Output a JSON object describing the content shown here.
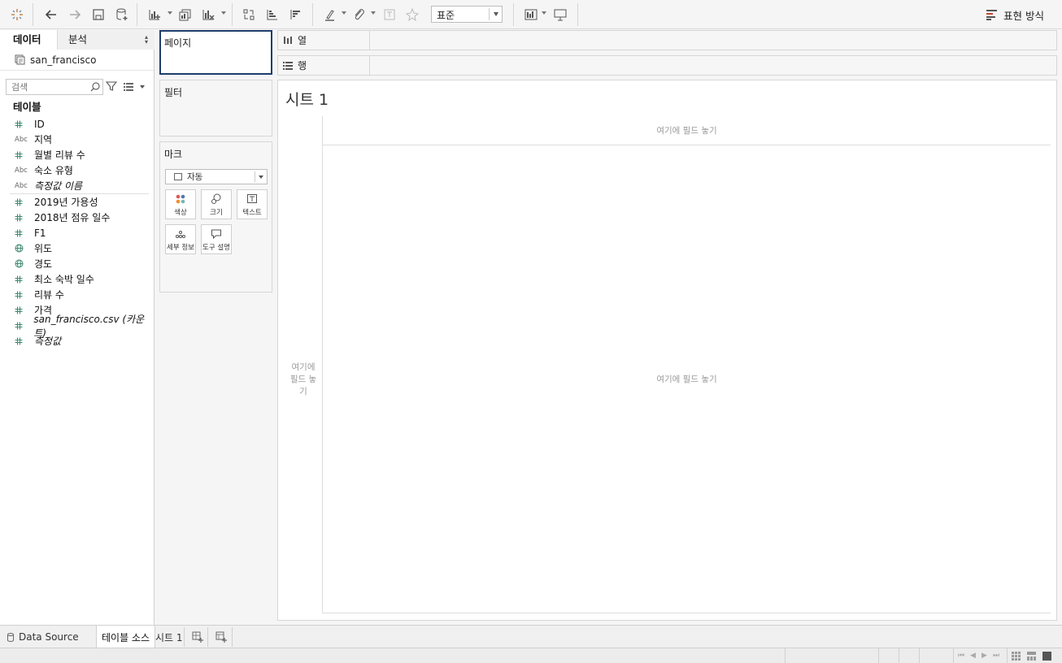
{
  "toolbar": {
    "format_select": "표준",
    "show_me": "표현 방식"
  },
  "data_pane": {
    "tab_data": "데이터",
    "tab_analysis": "분석",
    "datasource": "san_francisco",
    "search_placeholder": "검색",
    "tables_header": "테이블",
    "fields": [
      {
        "type": "#",
        "label": "ID",
        "italic": false
      },
      {
        "type": "Abc",
        "label": "지역",
        "italic": false
      },
      {
        "type": "#",
        "label": "월별 리뷰 수",
        "italic": false
      },
      {
        "type": "Abc",
        "label": "숙소 유형",
        "italic": false
      },
      {
        "type": "Abc",
        "label": "측정값 이름",
        "italic": true
      }
    ],
    "measures": [
      {
        "type": "#",
        "label": "2019년 가용성",
        "italic": false
      },
      {
        "type": "#",
        "label": "2018년 점유 일수",
        "italic": false
      },
      {
        "type": "#",
        "label": "F1",
        "italic": false
      },
      {
        "type": "globe",
        "label": "위도",
        "italic": false
      },
      {
        "type": "globe",
        "label": "경도",
        "italic": false
      },
      {
        "type": "#",
        "label": "최소 숙박 일수",
        "italic": false
      },
      {
        "type": "#",
        "label": "리뷰 수",
        "italic": false
      },
      {
        "type": "#",
        "label": "가격",
        "italic": false
      },
      {
        "type": "#",
        "label": "san_francisco.csv (카운트)",
        "italic": true
      },
      {
        "type": "#",
        "label": "측정값",
        "italic": true
      }
    ]
  },
  "cards": {
    "pages": "페이지",
    "filters": "필터",
    "marks": "마크",
    "mark_type": "자동",
    "color": "색상",
    "size": "크기",
    "text": "텍스트",
    "detail": "세부 정보",
    "tooltip": "도구 설명"
  },
  "shelves": {
    "columns": "열",
    "rows": "행"
  },
  "canvas": {
    "sheet_title": "시트 1",
    "drop_field_top": "여기에 필드 놓기",
    "drop_field_left": "여기에 필드 놓기",
    "drop_field_main": "여기에 필드 놓기"
  },
  "tabs": {
    "data_source": "Data Source",
    "datasource_tab": "테이블 소스",
    "sheet1": "시트 1"
  }
}
